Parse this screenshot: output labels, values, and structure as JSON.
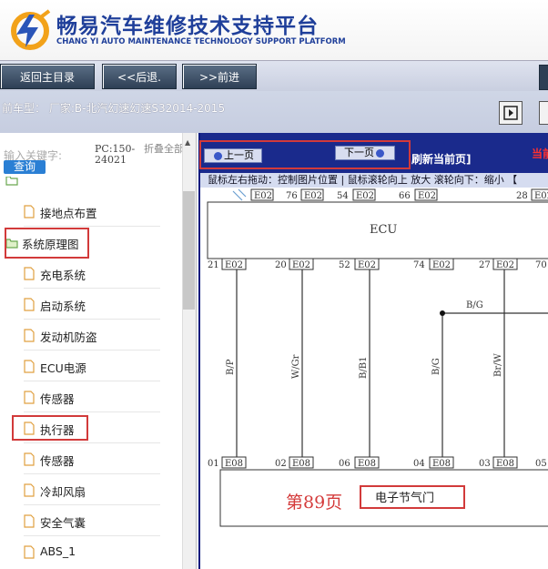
{
  "header": {
    "title_cn": "畅易汽车维修技术支持平台",
    "title_en": "CHANG YI AUTO MAINTENANCE TECHNOLOGY SUPPORT PLATFORM"
  },
  "nav": {
    "home": "返回主目录",
    "back": "<<后退.",
    "forward": ">>前进"
  },
  "model": {
    "text": "前车型：  厂家:B-北汽幻速幻速S32014-2015"
  },
  "sidebar": {
    "search_label": "输入关键字:",
    "search_button": "查询",
    "pc_label": "PC:150-24021",
    "fold_label": "折叠全部",
    "items": [
      {
        "label": "接地点布置"
      },
      {
        "label": "系统原理图"
      },
      {
        "label": "充电系统"
      },
      {
        "label": "启动系统"
      },
      {
        "label": "发动机防盗"
      },
      {
        "label": "ECU电源"
      },
      {
        "label": "传感器"
      },
      {
        "label": "执行器"
      },
      {
        "label": "传感器"
      },
      {
        "label": "冷却风扇"
      },
      {
        "label": "安全气囊"
      },
      {
        "label": "ABS_1"
      }
    ]
  },
  "viewer": {
    "prev": "上一页",
    "next": "下一页",
    "refresh": "刷新当前页]",
    "current": "当前",
    "hint": "鼠标左右拖动：控制图片位置 | 鼠标滚轮向上 放大  滚轮向下：缩小 【",
    "page_label": "第89页",
    "component_label": "电子节气门"
  },
  "diagram": {
    "ecu_label": "ECU",
    "top_pins": [
      "E02",
      "76",
      "E02",
      "54",
      "E02",
      "66",
      "E02",
      "28",
      "E02"
    ],
    "top_row2": [
      "21",
      "E02",
      "20",
      "E02",
      "52",
      "E02",
      "74",
      "E02",
      "27",
      "E02",
      "70"
    ],
    "wires": [
      "B/P",
      "W/Gr",
      "B/B1",
      "B/G",
      "Br/W"
    ],
    "branch_label": "B/G",
    "bottom_pins": [
      "01",
      "E08",
      "02",
      "E08",
      "06",
      "E08",
      "04",
      "E08",
      "03",
      "E08",
      "05"
    ]
  },
  "colors": {
    "brand_blue": "#1f3f9a",
    "viewer_blue": "#1a2a8c",
    "highlight_red": "#d23a3a",
    "search_blue": "#2a7fd4"
  }
}
